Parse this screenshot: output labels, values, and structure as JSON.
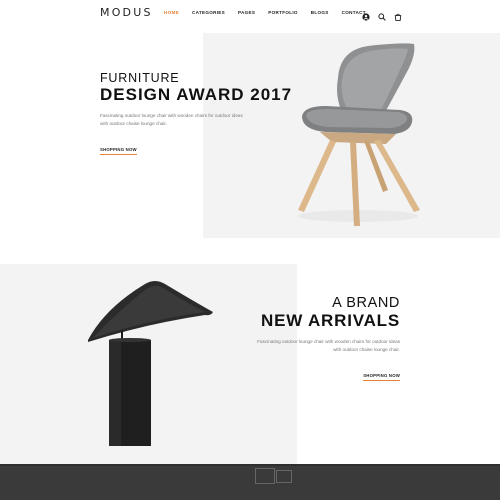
{
  "header": {
    "logo": "MODUS",
    "nav": [
      "HOME",
      "CATEGORIES",
      "PAGES",
      "PORTFOLIO",
      "BLOGS",
      "CONTACT"
    ],
    "active_nav": "HOME",
    "icons": [
      "user-icon",
      "search-icon",
      "cart-icon"
    ]
  },
  "hero1": {
    "subtitle": "FURNITURE",
    "title": "DESIGN AWARD 2017",
    "desc_line1": "Fascinating outdoor lounge chair with wooden chairs for outdoor ideas",
    "desc_line2": "with outdoor chaise lounge chair.",
    "button": "SHOPPING NOW"
  },
  "hero2": {
    "subtitle": "A BRAND",
    "title": "NEW ARRIVALS",
    "desc_line1": "Fascinating outdoor lounge chair with wooden chairs for outdoor ideas",
    "desc_line2": "with outdoor chaise lounge chair.",
    "button": "SHOPPING NOW"
  },
  "colors": {
    "accent": "#e8833a",
    "panel": "#f3f3f3",
    "dark": "#3a3a3a"
  }
}
